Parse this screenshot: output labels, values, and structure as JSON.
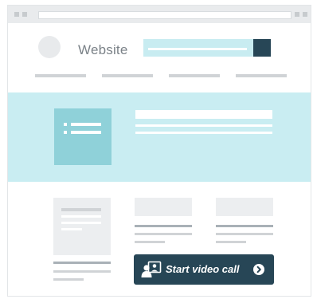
{
  "window": {
    "site_name": "Website"
  },
  "video_call": {
    "label": "Start video call",
    "icon": "video-call-people-icon",
    "action_icon": "chevron-right-circle-icon"
  },
  "colors": {
    "accent_dark": "#274656",
    "hero_background": "#c9edf2",
    "hero_thumbnail": "#8fd1d9",
    "placeholder_gray": "#eceef0"
  }
}
